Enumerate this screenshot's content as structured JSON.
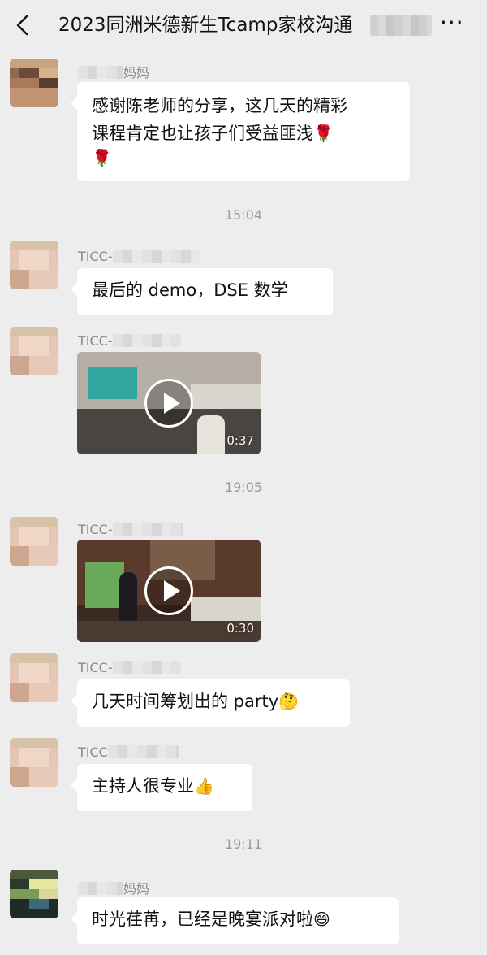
{
  "header": {
    "title": "2023同洲米德新生Tcamp家校沟通",
    "more_label": "···"
  },
  "messages": [
    {
      "sender": "妈妈",
      "text_line1": "感谢陈老师的分享，这几天的精彩",
      "text_line2": "课程肯定也让孩子们受益匪浅",
      "emoji": "🌹"
    },
    {
      "time": "15:04"
    },
    {
      "sender": "TICC-",
      "text": "最后的 demo，DSE 数学"
    },
    {
      "sender": "TICC-",
      "video_duration": "0:37"
    },
    {
      "time": "19:05"
    },
    {
      "sender": "TICC-",
      "video_duration": "0:30"
    },
    {
      "sender": "TICC-",
      "text": "几天时间筹划出的 party",
      "emoji": "🤔"
    },
    {
      "sender": "TICC",
      "text": "主持人很专业",
      "emoji": "👍"
    },
    {
      "time": "19:11"
    },
    {
      "sender": "妈妈",
      "text": "时光荏苒，已经是晚宴派对啦",
      "emoji": "😄"
    }
  ]
}
